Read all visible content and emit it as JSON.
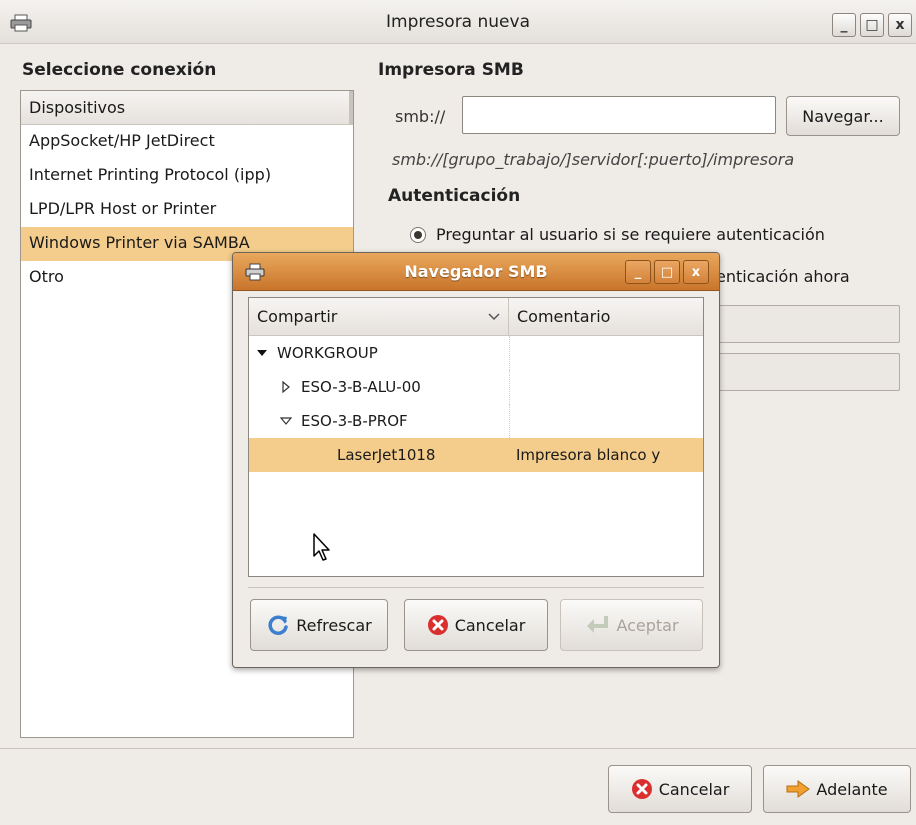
{
  "window": {
    "title": "Impresora nueva",
    "controls": {
      "minimize": "_",
      "maximize": "□",
      "close": "x"
    }
  },
  "connection": {
    "heading": "Seleccione conexión",
    "header": "Dispositivos",
    "items": [
      "AppSocket/HP JetDirect",
      "Internet Printing Protocol (ipp)",
      "LPD/LPR Host or Printer",
      "Windows Printer via SAMBA",
      "Otro"
    ],
    "selected_index": 3
  },
  "smb": {
    "heading": "Impresora SMB",
    "prefix": "smb://",
    "url_value": "",
    "browse_label": "Navegar...",
    "hint": "smb://[grupo_trabajo/]servidor[:puerto]/impresora"
  },
  "auth": {
    "heading": "Autenticación",
    "options": [
      "Preguntar al usuario si se requiere autenticación",
      "Establecer los detalles de autenticación ahora"
    ],
    "selected_index": 0,
    "option2_visible": "enticación ahora"
  },
  "footer": {
    "cancel": "Cancelar",
    "forward": "Adelante"
  },
  "dialog": {
    "title": "Navegador SMB",
    "columns": {
      "share": "Compartir",
      "comment": "Comentario"
    },
    "rows": [
      {
        "name": "WORKGROUP",
        "comment": "",
        "expander": "expanded"
      },
      {
        "name": "ESO-3-B-ALU-00",
        "comment": "",
        "expander": "collapsed"
      },
      {
        "name": "ESO-3-B-PROF",
        "comment": "",
        "expander": "expanded"
      },
      {
        "name": "LaserJet1018",
        "comment": "Impresora blanco y",
        "expander": "none"
      }
    ],
    "selected_row": 3,
    "buttons": {
      "refresh": "Refrescar",
      "cancel": "Cancelar",
      "accept": "Aceptar"
    }
  },
  "colors": {
    "selection": "#f4cd8c",
    "dialog_titlebar": "#d9883d",
    "window_bg": "#efebe7",
    "danger": "#d9302f",
    "refresh_blue": "#3c7fcf",
    "forward_orange": "#f0a030"
  },
  "icons": {
    "app": "printer-icon",
    "refresh": "refresh-icon",
    "cancel": "cancel-icon",
    "accept": "accept-icon",
    "forward": "forward-arrow-icon",
    "cursor": "mouse-pointer-icon"
  }
}
